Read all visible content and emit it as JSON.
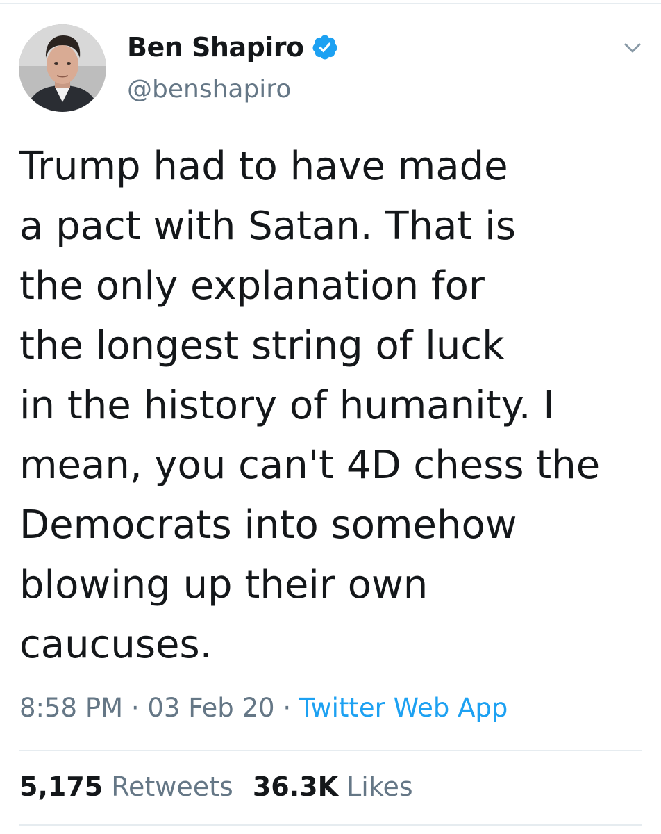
{
  "colors": {
    "text": "#14171a",
    "muted": "#657786",
    "link": "#1da1f2",
    "verified": "#1da1f2",
    "divider": "#e6ecf0"
  },
  "author": {
    "display_name": "Ben Shapiro",
    "handle": "@benshapiro",
    "verified_icon": "verified-badge-icon",
    "avatar_icon": "profile-photo"
  },
  "menu": {
    "icon": "chevron-down-icon"
  },
  "tweet": {
    "lines": [
      "Trump had to have made",
      "a pact with Satan. That is",
      "the only explanation for",
      "the longest string of luck",
      "in the history of humanity. I",
      "mean, you can't 4D chess the",
      "Democrats into somehow",
      "blowing up their own",
      "caucuses."
    ]
  },
  "meta": {
    "time": "8:58 PM",
    "separator": "·",
    "date": "03 Feb 20",
    "source": "Twitter Web App"
  },
  "stats": {
    "retweets_count": "5,175",
    "retweets_label": "Retweets",
    "likes_count": "36.3K",
    "likes_label": "Likes"
  }
}
